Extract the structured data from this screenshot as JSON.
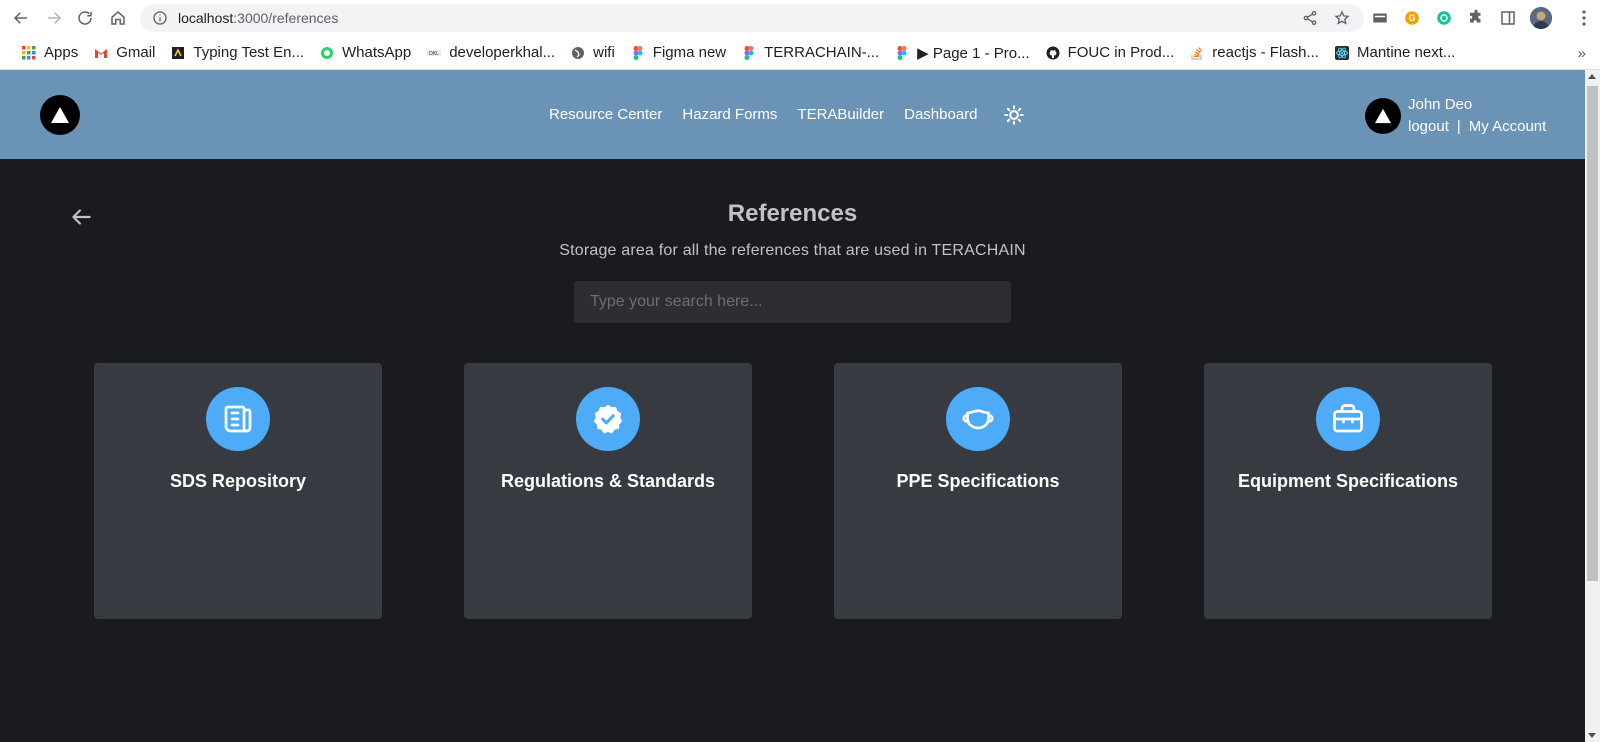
{
  "browser": {
    "url_host": "localhost",
    "url_path": ":3000/references",
    "bookmarks": [
      {
        "label": "Apps",
        "icon": "apps-grid-icon",
        "color": "#ea4335"
      },
      {
        "label": "Gmail",
        "icon": "gmail-icon",
        "color": "#ea4335"
      },
      {
        "label": "Typing Test En...",
        "icon": "typing-test-icon",
        "color": "#202124"
      },
      {
        "label": "WhatsApp",
        "icon": "whatsapp-icon",
        "color": "#25d366"
      },
      {
        "label": "developerkhal...",
        "icon": "dev-icon",
        "color": "#5f6368"
      },
      {
        "label": "wifi",
        "icon": "globe-icon",
        "color": "#5f6368"
      },
      {
        "label": "Figma new",
        "icon": "figma-icon",
        "color": "#f24e1e"
      },
      {
        "label": "TERRACHAIN-...",
        "icon": "figma-icon",
        "color": "#f24e1e"
      },
      {
        "label": "▶ Page 1 - Pro...",
        "icon": "figma-icon",
        "color": "#f24e1e"
      },
      {
        "label": "FOUC in Prod...",
        "icon": "github-icon",
        "color": "#202124"
      },
      {
        "label": "reactjs - Flash...",
        "icon": "stackoverflow-icon",
        "color": "#f48024"
      },
      {
        "label": "Mantine next...",
        "icon": "react-icon",
        "color": "#228be6"
      }
    ],
    "overflow": "»"
  },
  "header": {
    "nav": [
      "Resource Center",
      "Hazard Forms",
      "TERABuilder",
      "Dashboard"
    ],
    "user_name": "John Deo",
    "logout": "logout",
    "separator": "|",
    "my_account": "My Account"
  },
  "main": {
    "title": "References",
    "subtitle": "Storage area for all the references that are used in TERACHAIN",
    "search_placeholder": "Type your search here...",
    "cards": [
      {
        "title": "SDS Repository",
        "icon": "news-icon"
      },
      {
        "title": "Regulations & Standards",
        "icon": "verified-badge-icon"
      },
      {
        "title": "PPE Specifications",
        "icon": "mask-icon"
      },
      {
        "title": "Equipment Specifications",
        "icon": "briefcase-icon"
      }
    ]
  },
  "colors": {
    "header_bg": "#6b93b6",
    "page_bg": "#1a1b1e",
    "card_bg": "#373a40",
    "accent": "#4dabf7"
  }
}
